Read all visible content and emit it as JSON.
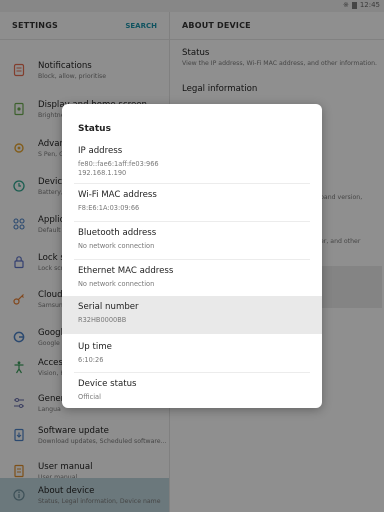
{
  "status_bar": {
    "time": "12:45"
  },
  "settings": {
    "title": "SETTINGS",
    "search_label": "SEARCH",
    "items": [
      {
        "title": "Notifications",
        "subtitle": "Block, allow, prioritise",
        "icon": "notifications-icon"
      },
      {
        "title": "Display and home screen",
        "subtitle": "Brightness",
        "icon": "display-icon"
      },
      {
        "title": "Advan",
        "subtitle": "S Pen, G",
        "icon": "advanced-icon"
      },
      {
        "title": "Device",
        "subtitle": "Battery,",
        "icon": "device-maintenance-icon"
      },
      {
        "title": "Applic",
        "subtitle": "Default a",
        "icon": "apps-icon"
      },
      {
        "title": "Lock s",
        "subtitle": "Lock scr",
        "icon": "lock-icon"
      },
      {
        "title": "Cloud",
        "subtitle": "Samsun",
        "icon": "key-icon"
      },
      {
        "title": "Google",
        "subtitle": "Google",
        "icon": "google-icon"
      },
      {
        "title": "Access",
        "subtitle": "Vision, H",
        "icon": "accessibility-icon"
      },
      {
        "title": "Genera",
        "subtitle": "Langua",
        "icon": "sliders-icon"
      },
      {
        "title": "Software update",
        "subtitle": "Download updates, Scheduled software...",
        "icon": "software-update-icon"
      },
      {
        "title": "User manual",
        "subtitle": "User manual",
        "icon": "manual-icon"
      },
      {
        "title": "About device",
        "subtitle": "Status, Legal information, Device name",
        "icon": "info-icon"
      }
    ]
  },
  "about": {
    "title": "ABOUT DEVICE",
    "items": [
      {
        "title": "Status",
        "subtitle": "View the IP address, Wi-Fi MAC address, and other information."
      },
      {
        "title": "Legal information",
        "subtitle": ""
      }
    ],
    "partial": [
      "band version,",
      "er, and other"
    ]
  },
  "dialog": {
    "title": "Status",
    "rows": [
      {
        "label": "IP address",
        "value": "fe80::fae6:1aff:fe03:966\n192.168.1.190"
      },
      {
        "label": "Wi-Fi MAC address",
        "value": "F8:E6:1A:03:09:66"
      },
      {
        "label": "Bluetooth address",
        "value": "No network connection"
      },
      {
        "label": "Ethernet MAC address",
        "value": "No network connection"
      },
      {
        "label": "Serial number",
        "value": "R32HB0000BB"
      },
      {
        "label": "Up time",
        "value": "6:10:26"
      },
      {
        "label": "Device status",
        "value": "Official"
      }
    ]
  }
}
